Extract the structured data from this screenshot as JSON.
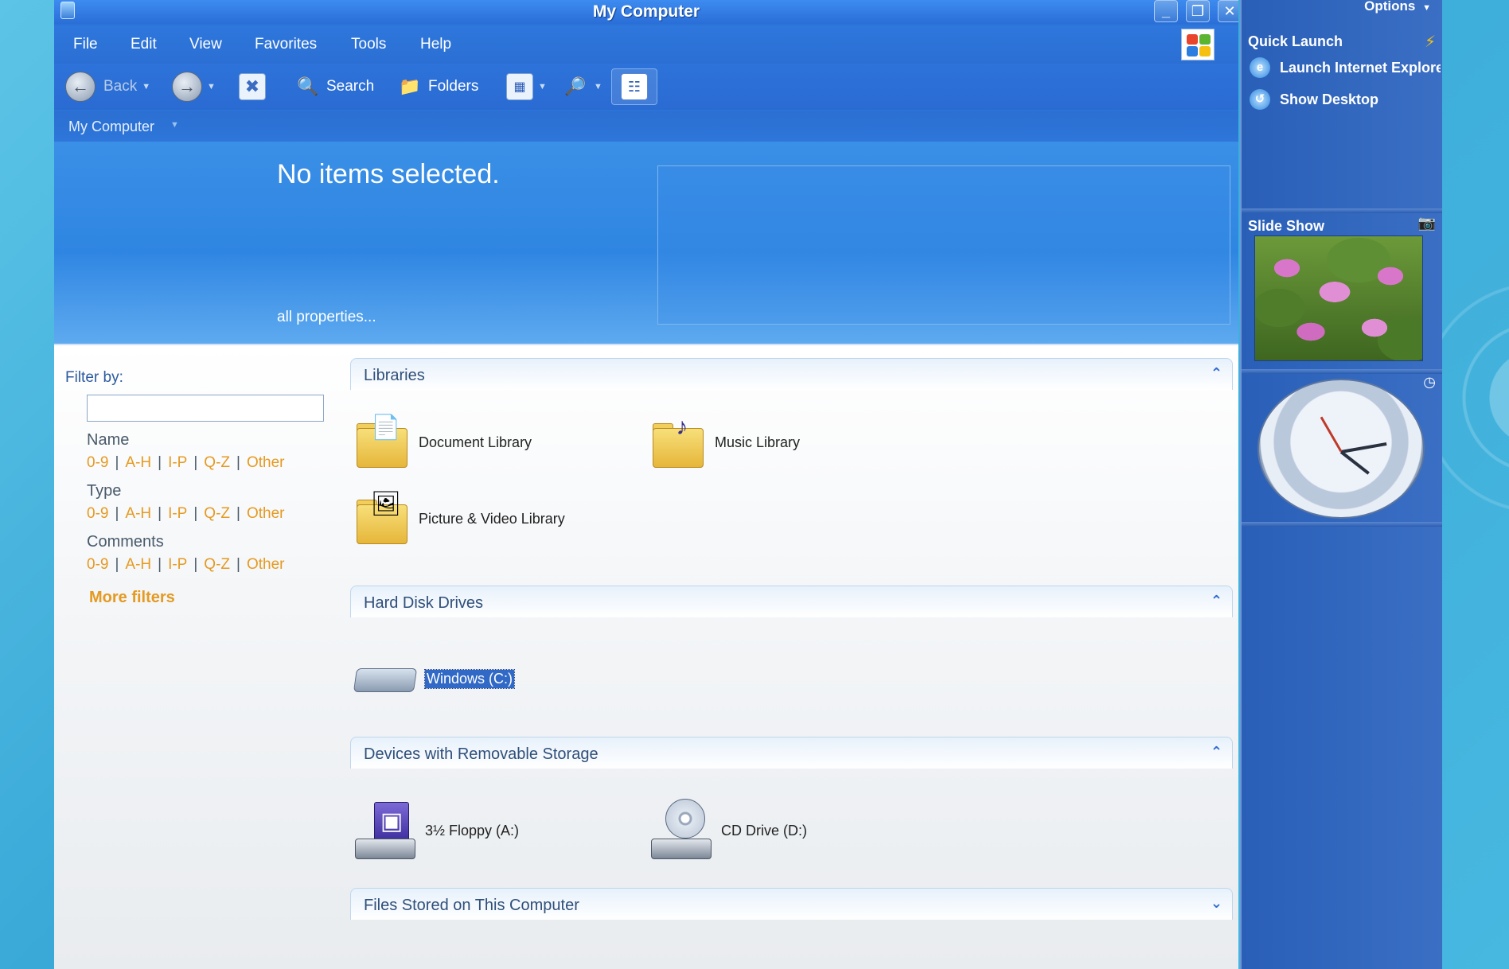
{
  "window": {
    "title": "My Computer",
    "controls": {
      "minimize": "_",
      "restore": "❐",
      "close": "✕"
    }
  },
  "menu": [
    "File",
    "Edit",
    "View",
    "Favorites",
    "Tools",
    "Help"
  ],
  "toolbar": {
    "back_label": "Back",
    "search_label": "Search",
    "folders_label": "Folders"
  },
  "address": {
    "label": "My Computer"
  },
  "details": {
    "status": "No items selected.",
    "all_properties": "all properties..."
  },
  "filter": {
    "title": "Filter by:",
    "input_value": "",
    "groups": [
      {
        "name": "Name",
        "links": [
          "0-9",
          "A-H",
          "I-P",
          "Q-Z",
          "Other"
        ]
      },
      {
        "name": "Type",
        "links": [
          "0-9",
          "A-H",
          "I-P",
          "Q-Z",
          "Other"
        ]
      },
      {
        "name": "Comments",
        "links": [
          "0-9",
          "A-H",
          "I-P",
          "Q-Z",
          "Other"
        ]
      }
    ],
    "more": "More filters",
    "separator": "|"
  },
  "sections": {
    "libraries": {
      "title": "Libraries",
      "items": [
        "Document Library",
        "Music Library",
        "Picture & Video Library"
      ]
    },
    "hard_disks": {
      "title": "Hard Disk Drives",
      "items": [
        "Windows (C:)"
      ]
    },
    "removable": {
      "title": "Devices with Removable Storage",
      "items": [
        "3½ Floppy (A:)",
        "CD Drive (D:)"
      ]
    },
    "files": {
      "title": "Files Stored on This Computer"
    }
  },
  "sidebar": {
    "options": "Options",
    "quick_launch": "Quick Launch",
    "items": [
      "Launch Internet Explorer",
      "Show Desktop"
    ],
    "slide_show": "Slide Show"
  },
  "colors": {
    "accent": "#2b73d6",
    "filter_link": "#e59a22",
    "selection": "#3169c6"
  }
}
